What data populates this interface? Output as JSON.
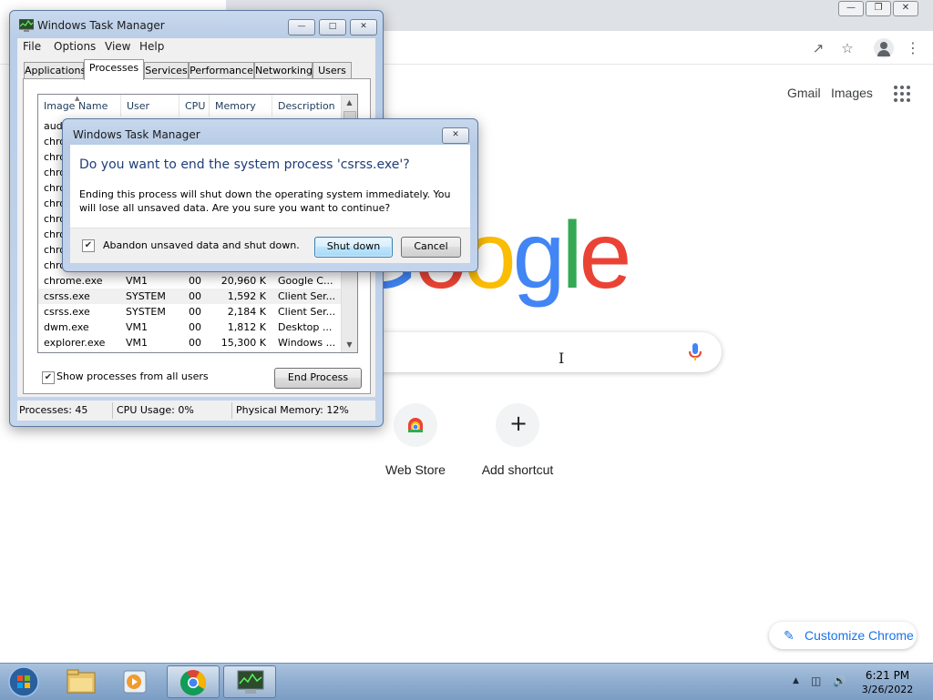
{
  "chrome": {
    "links": {
      "gmail": "Gmail",
      "images": "Images"
    },
    "logo": "Google",
    "shortcuts": [
      {
        "label": "Web Store",
        "icon": "webstore-icon"
      },
      {
        "label": "Add shortcut",
        "icon": "plus-icon"
      }
    ],
    "customize_label": "Customize Chrome",
    "colors": {
      "blue": "#4285f4",
      "red": "#ea4335",
      "yellow": "#fbbc05",
      "green": "#34a853"
    }
  },
  "task_manager": {
    "title": "Windows Task Manager",
    "menu": [
      "File",
      "Options",
      "View",
      "Help"
    ],
    "tabs": [
      "Applications",
      "Processes",
      "Services",
      "Performance",
      "Networking",
      "Users"
    ],
    "active_tab": "Processes",
    "columns": [
      "Image Name",
      "User Name",
      "CPU",
      "Memory (...",
      "Description"
    ],
    "rows": [
      {
        "name": "audi",
        "user": "",
        "cpu": "",
        "mem": "",
        "desc": ""
      },
      {
        "name": "chro",
        "user": "",
        "cpu": "",
        "mem": "",
        "desc": ""
      },
      {
        "name": "chro",
        "user": "",
        "cpu": "",
        "mem": "",
        "desc": ""
      },
      {
        "name": "chro",
        "user": "",
        "cpu": "",
        "mem": "",
        "desc": ""
      },
      {
        "name": "chro",
        "user": "",
        "cpu": "",
        "mem": "",
        "desc": ""
      },
      {
        "name": "chro",
        "user": "",
        "cpu": "",
        "mem": "",
        "desc": ""
      },
      {
        "name": "chro",
        "user": "",
        "cpu": "",
        "mem": "",
        "desc": ""
      },
      {
        "name": "chro",
        "user": "",
        "cpu": "",
        "mem": "",
        "desc": ""
      },
      {
        "name": "chro",
        "user": "",
        "cpu": "",
        "mem": "",
        "desc": ""
      },
      {
        "name": "chro",
        "user": "",
        "cpu": "",
        "mem": "",
        "desc": ""
      },
      {
        "name": "chrome.exe",
        "user": "VM1",
        "cpu": "00",
        "mem": "20,960 K",
        "desc": "Google C..."
      },
      {
        "name": "csrss.exe",
        "user": "SYSTEM",
        "cpu": "00",
        "mem": "1,592 K",
        "desc": "Client Ser..."
      },
      {
        "name": "csrss.exe",
        "user": "SYSTEM",
        "cpu": "00",
        "mem": "2,184 K",
        "desc": "Client Ser..."
      },
      {
        "name": "dwm.exe",
        "user": "VM1",
        "cpu": "00",
        "mem": "1,812 K",
        "desc": "Desktop ..."
      },
      {
        "name": "explorer.exe",
        "user": "VM1",
        "cpu": "00",
        "mem": "15,300 K",
        "desc": "Windows ..."
      }
    ],
    "selected_row_index": 11,
    "show_all_users_label": "Show processes from all users",
    "show_all_users_checked": true,
    "end_process_label": "End Process",
    "status": {
      "processes": "Processes: 45",
      "cpu": "CPU Usage: 0%",
      "memory": "Physical Memory: 12%"
    }
  },
  "dialog": {
    "title": "Windows Task Manager",
    "heading": "Do you want to end the system process 'csrss.exe'?",
    "body": "Ending this process will shut down the operating system immediately.  You will lose all unsaved data.  Are you sure you want to continue?",
    "checkbox_label": "Abandon unsaved data and shut down.",
    "checkbox_checked": true,
    "shutdown_label": "Shut down",
    "cancel_label": "Cancel"
  },
  "taskbar": {
    "items": [
      {
        "name": "start-button",
        "icon": "windows-orb-icon"
      },
      {
        "name": "explorer",
        "icon": "folder-icon"
      },
      {
        "name": "media-player",
        "icon": "media-player-icon"
      },
      {
        "name": "chrome",
        "icon": "chrome-icon"
      },
      {
        "name": "task-manager",
        "icon": "task-manager-icon"
      }
    ],
    "time": "6:21 PM",
    "date": "3/26/2022"
  }
}
